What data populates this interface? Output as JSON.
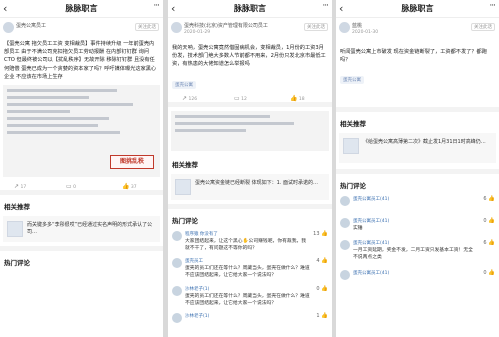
{
  "panels": [
    {
      "title": "脉脉职言",
      "author": "蛋壳公寓员工",
      "date": "",
      "follow": "关注此话",
      "content": "【蛋壳公寓 拖欠员工工资 变相裁员】事件持续升级 一年前蛋壳内部员工 由于不满公司克扣拖欠员工劳动报酬 在内部钉钉群 询问CTO 但最终被公司以【扰乱秩序】无故开除 移除钉钉群 且没有任何赔偿 蛋壳已成为一个贪婪的资本家了吗？呼吁媒体曝光这家黑心企业 不应该在市场上生存",
      "stamp": "图挑乱秩",
      "actions": [
        "17",
        "0",
        "37"
      ],
      "related_title": "相关推荐",
      "related_text": "而关键多多“李彤很哎”已经通过实名声明的形式承认了公司…",
      "comments_title": "热门评论"
    },
    {
      "title": "脉脉职言",
      "author": "蛋壳科技(北京)资产管理有限公司员工",
      "date": "2020-01-29",
      "follow": "关注此话",
      "content": "我的天呐，蛋壳公寓竟然借固病机会，变相裁员，1月份的工资3月份发，技术部门绝大多数人节前都不用来，2月份只发北京市最低工资，有热患的大佬知道怎么举报吗",
      "tag": "蛋壳公寓",
      "actions": [
        "126",
        "12",
        "18"
      ],
      "related_title": "相关推荐",
      "related_text": "蛋壳公寓资金链已经断裂 体现如下：1. 面试时承诺的…",
      "comments_title": "热门评论",
      "comments": [
        {
          "name": "程序猿 你没有了",
          "text": "大家团结起来，让这个黑心✋公司赚钱呢，你有裁我，我就不干了，有问题这不等你的吗？",
          "likes": "13"
        },
        {
          "name": "蛋壳员工",
          "text": "蛋壳的员工们还在等什么？周藏当头，蛋壳在做什么？难道不应该团结起来，让它给大家一个说法吗？",
          "likes": "4"
        },
        {
          "name": "沙林老子(1)",
          "text": "蛋壳的员工们还在等什么？周藏当头，蛋壳在做什么？难道不应该团结起来，让它给大家一个说法吗？",
          "likes": "0"
        },
        {
          "name": "沙林老子(1)",
          "text": "",
          "likes": "1"
        }
      ]
    },
    {
      "title": "脉脉职言",
      "author": "蓝桃",
      "date": "2020-01-30",
      "follow": "关注此话",
      "content": "听闻蛋壳公寓上市破发 现在资金链断裂了，工资都不发了？都跑吗？",
      "tag": "蛋壳公寓",
      "related_title": "相关推荐",
      "related_text": "《给蛋壳公寓高薄第二次》截止发1月31日1时高峰仍…",
      "comments_title": "热门评论",
      "comments": [
        {
          "name": "蛋壳公寓员工(41)",
          "text": "",
          "likes": "6"
        },
        {
          "name": "蛋壳公寓员工(41)",
          "text": "实锤",
          "likes": "0"
        },
        {
          "name": "蛋壳公寓员工(41)",
          "text": "一月工资延期，奖金不发，二月工资只发基本工资！无全不说两点之类",
          "likes": "6"
        },
        {
          "name": "蛋壳公寓员工(41)",
          "text": "",
          "likes": "0"
        }
      ]
    }
  ]
}
